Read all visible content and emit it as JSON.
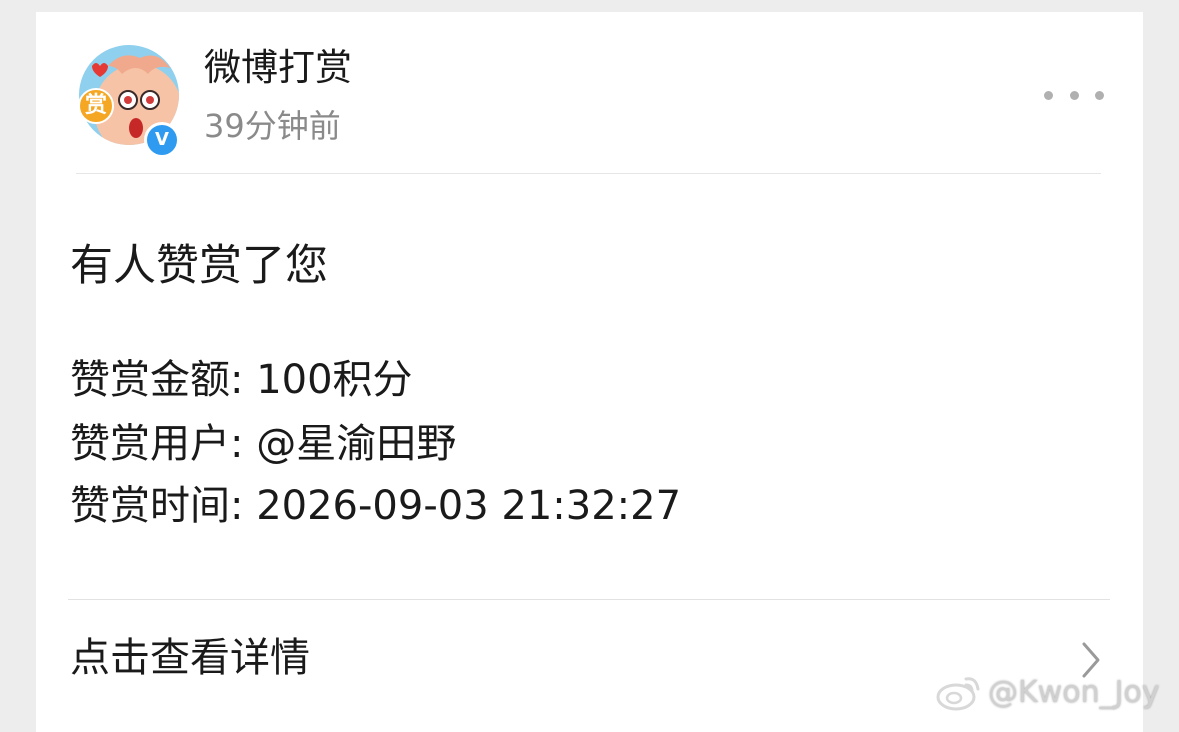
{
  "post": {
    "sender_name": "微博打赏",
    "timestamp": "39分钟前",
    "avatar_badge_text": "赏",
    "verified_badge_text": "V",
    "headline": "有人赞赏了您",
    "details": {
      "amount": "赞赏金额: 100积分",
      "user": "赞赏用户: @星渝田野",
      "time": "赞赏时间: 2026-09-03 21:32:27"
    },
    "view_details_label": "点击查看详情"
  },
  "watermark": {
    "text": "@Kwon_Joy"
  },
  "colors": {
    "page_background": "#ededed",
    "card_background": "#ffffff",
    "primary_text": "#1a1a1a",
    "secondary_text": "#8a8a8a",
    "verified_blue": "#2e9bf0",
    "badge_orange": "#f5a623",
    "avatar_background": "#8fd0ee"
  },
  "icons": [
    "more-icon",
    "chevron-right-icon",
    "verified-badge-icon",
    "weibo-logo-icon"
  ]
}
